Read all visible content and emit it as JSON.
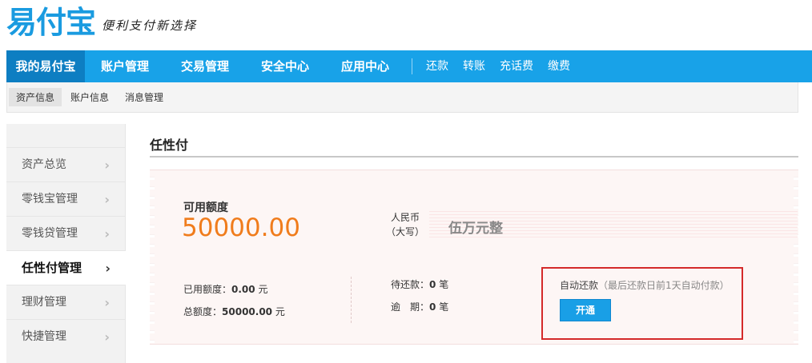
{
  "header": {
    "logo_text": "易付宝",
    "slogan": "便利支付新选择"
  },
  "main_nav": {
    "items": [
      {
        "label": "我的易付宝"
      },
      {
        "label": "账户管理"
      },
      {
        "label": "交易管理"
      },
      {
        "label": "安全中心"
      },
      {
        "label": "应用中心"
      }
    ],
    "quick_links": [
      {
        "label": "还款"
      },
      {
        "label": "转账"
      },
      {
        "label": "充话费"
      },
      {
        "label": "缴费"
      }
    ]
  },
  "sub_nav": {
    "items": [
      {
        "label": "资产信息"
      },
      {
        "label": "账户信息"
      },
      {
        "label": "消息管理"
      }
    ]
  },
  "sidebar": {
    "items": [
      {
        "label": "资产总览"
      },
      {
        "label": "零钱宝管理"
      },
      {
        "label": "零钱贷管理"
      },
      {
        "label": "任性付管理"
      },
      {
        "label": "理财管理"
      },
      {
        "label": "快捷管理"
      }
    ],
    "chevron": "›"
  },
  "content": {
    "title": "任性付",
    "available_label": "可用额度",
    "available_amount": "50000.00",
    "rmb_label_line1": "人民币",
    "rmb_label_line2": "（大写）",
    "rmb_value": "伍万元整",
    "used_label": "已用额度：",
    "used_value": "0.00",
    "used_unit": "元",
    "total_label": "总额度：",
    "total_value": "50000.00",
    "total_unit": "元",
    "pending_label": "待还款：",
    "pending_value": "0",
    "pending_unit": "笔",
    "overdue_label": "逾　期：",
    "overdue_value": "0",
    "overdue_unit": "笔",
    "auto_repay_label": "自动还款",
    "auto_repay_hint": "（最后还款日前1天自动付款）",
    "open_button": "开通"
  },
  "colors": {
    "brand_blue": "#18a2e8",
    "nav_active": "#0d7ec2",
    "amount_orange": "#f07c1c",
    "highlight_red": "#d42a2a"
  }
}
